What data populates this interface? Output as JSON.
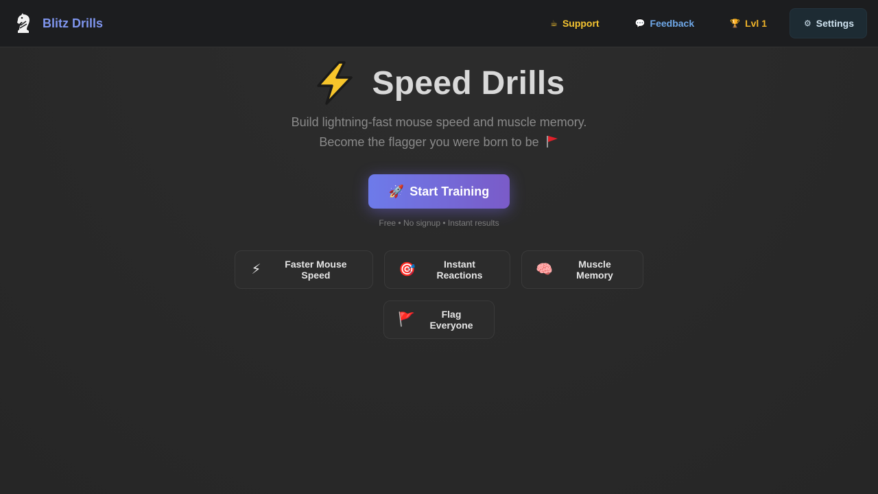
{
  "brand": {
    "name": "Blitz Drills",
    "logo_icon": "knight-icon",
    "accent": "#7f95ee"
  },
  "nav": [
    {
      "label": "Support",
      "icon": "coffee-icon",
      "glyph": "☕",
      "color": "#f6c531"
    },
    {
      "label": "Feedback",
      "icon": "speech-bubble-icon",
      "glyph": "💬",
      "color": "#6fa8e8"
    },
    {
      "label": "Lvl 1",
      "icon": "trophy-icon",
      "glyph": "🏆",
      "color": "#f0b429"
    },
    {
      "label": "Settings",
      "icon": "gear-icon",
      "glyph": "⚙",
      "color": "#cfe3f0"
    }
  ],
  "hero": {
    "title": "Speed Drills",
    "title_icon": "lightning-icon",
    "subtitle_line1": "Build lightning-fast mouse speed and muscle memory.",
    "subtitle_line2": "Become the flagger you were born to be",
    "subtitle_icon": "red-flag-icon"
  },
  "cta": {
    "label": "Start Training",
    "icon": "rocket-icon",
    "glyph": "🚀",
    "note": "Free • No signup • Instant results",
    "gradient": [
      "#6d7bea",
      "#7a5bc8"
    ]
  },
  "features": [
    {
      "label": "Faster Mouse Speed",
      "icon": "lightning-icon",
      "glyph": "⚡"
    },
    {
      "label": "Instant Reactions",
      "icon": "target-icon",
      "glyph": "🎯"
    },
    {
      "label": "Muscle Memory",
      "icon": "brain-icon",
      "glyph": "🧠"
    },
    {
      "label": "Flag Everyone",
      "icon": "red-flag-icon",
      "glyph": "🚩"
    }
  ]
}
